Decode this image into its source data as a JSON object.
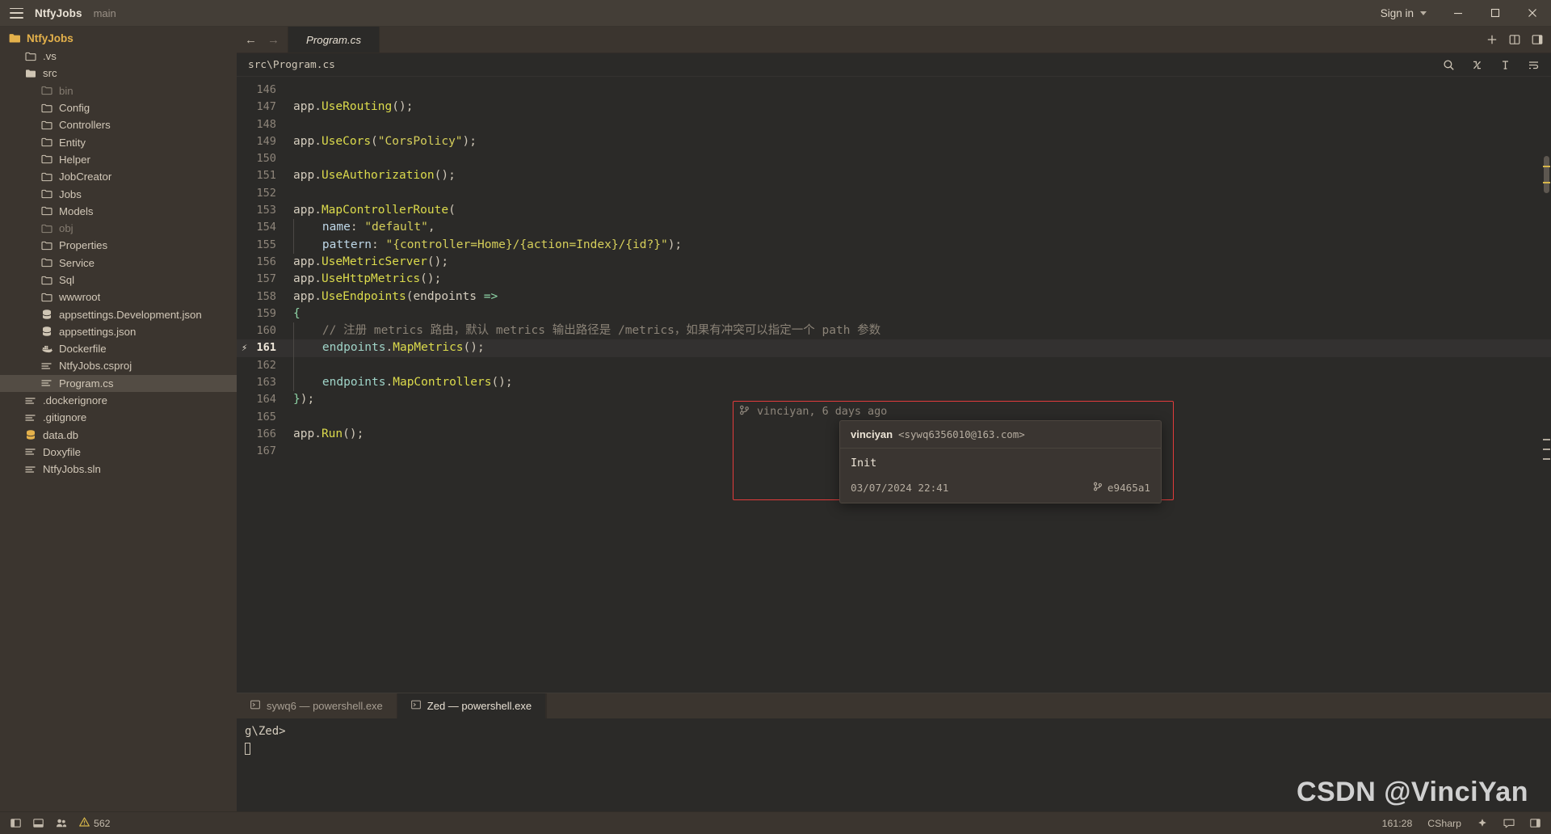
{
  "titlebar": {
    "menu_icon": "hamburger-icon",
    "project": "NtfyJobs",
    "branch": "main",
    "signin": "Sign in",
    "minimize": "minimize-icon",
    "maximize": "maximize-icon",
    "close": "close-icon"
  },
  "sidebar": {
    "root": "NtfyJobs",
    "items": [
      {
        "label": ".vs",
        "type": "folder",
        "depth": 1,
        "dim": false,
        "open": false
      },
      {
        "label": "src",
        "type": "folder-open",
        "depth": 1,
        "dim": false,
        "open": true
      },
      {
        "label": "bin",
        "type": "folder",
        "depth": 2,
        "dim": true,
        "open": false
      },
      {
        "label": "Config",
        "type": "folder",
        "depth": 2,
        "dim": false,
        "open": false
      },
      {
        "label": "Controllers",
        "type": "folder",
        "depth": 2,
        "dim": false,
        "open": false
      },
      {
        "label": "Entity",
        "type": "folder",
        "depth": 2,
        "dim": false,
        "open": false
      },
      {
        "label": "Helper",
        "type": "folder",
        "depth": 2,
        "dim": false,
        "open": false
      },
      {
        "label": "JobCreator",
        "type": "folder",
        "depth": 2,
        "dim": false,
        "open": false
      },
      {
        "label": "Jobs",
        "type": "folder",
        "depth": 2,
        "dim": false,
        "open": false
      },
      {
        "label": "Models",
        "type": "folder",
        "depth": 2,
        "dim": false,
        "open": false
      },
      {
        "label": "obj",
        "type": "folder",
        "depth": 2,
        "dim": true,
        "open": false
      },
      {
        "label": "Properties",
        "type": "folder",
        "depth": 2,
        "dim": false,
        "open": false
      },
      {
        "label": "Service",
        "type": "folder",
        "depth": 2,
        "dim": false,
        "open": false
      },
      {
        "label": "Sql",
        "type": "folder",
        "depth": 2,
        "dim": false,
        "open": false
      },
      {
        "label": "wwwroot",
        "type": "folder",
        "depth": 2,
        "dim": false,
        "open": false
      },
      {
        "label": "appsettings.Development.json",
        "type": "database",
        "depth": 2,
        "dim": false
      },
      {
        "label": "appsettings.json",
        "type": "database",
        "depth": 2,
        "dim": false
      },
      {
        "label": "Dockerfile",
        "type": "docker",
        "depth": 2,
        "dim": false
      },
      {
        "label": "NtfyJobs.csproj",
        "type": "lines",
        "depth": 2,
        "dim": false
      },
      {
        "label": "Program.cs",
        "type": "lines",
        "depth": 2,
        "dim": false,
        "selected": true
      },
      {
        "label": ".dockerignore",
        "type": "lines",
        "depth": 1,
        "dim": false
      },
      {
        "label": ".gitignore",
        "type": "lines",
        "depth": 1,
        "dim": false
      },
      {
        "label": "data.db",
        "type": "db-yellow",
        "depth": 1,
        "dim": false
      },
      {
        "label": "Doxyfile",
        "type": "lines",
        "depth": 1,
        "dim": false
      },
      {
        "label": "NtfyJobs.sln",
        "type": "lines",
        "depth": 1,
        "dim": false
      }
    ]
  },
  "tabbar": {
    "back": "←",
    "forward": "→",
    "tab_label": "Program.cs",
    "plus": "plus-icon",
    "split": "split-pane-icon",
    "panel": "toggle-right-panel-icon"
  },
  "breadcrumb": {
    "path": "src\\Program.cs",
    "search_icon": "search-icon",
    "gitdiff_icon": "git-diff-icon",
    "format_icon": "text-format-icon",
    "wrap_icon": "toggle-wrap-icon"
  },
  "editor": {
    "first_line": 146,
    "active_line": 161,
    "lines": [
      {
        "n": 146,
        "tokens": []
      },
      {
        "n": 147,
        "tokens": [
          {
            "t": "app",
            "c": "t-plain"
          },
          {
            "t": ".",
            "c": "t-punc"
          },
          {
            "t": "UseRouting",
            "c": "t-fn"
          },
          {
            "t": "();",
            "c": "t-punc"
          }
        ]
      },
      {
        "n": 148,
        "tokens": []
      },
      {
        "n": 149,
        "tokens": [
          {
            "t": "app",
            "c": "t-plain"
          },
          {
            "t": ".",
            "c": "t-punc"
          },
          {
            "t": "UseCors",
            "c": "t-fn"
          },
          {
            "t": "(",
            "c": "t-punc"
          },
          {
            "t": "\"CorsPolicy\"",
            "c": "t-str"
          },
          {
            "t": ");",
            "c": "t-punc"
          }
        ]
      },
      {
        "n": 150,
        "tokens": []
      },
      {
        "n": 151,
        "tokens": [
          {
            "t": "app",
            "c": "t-plain"
          },
          {
            "t": ".",
            "c": "t-punc"
          },
          {
            "t": "UseAuthorization",
            "c": "t-fn"
          },
          {
            "t": "();",
            "c": "t-punc"
          }
        ]
      },
      {
        "n": 152,
        "tokens": []
      },
      {
        "n": 153,
        "tokens": [
          {
            "t": "app",
            "c": "t-plain"
          },
          {
            "t": ".",
            "c": "t-punc"
          },
          {
            "t": "MapControllerRoute",
            "c": "t-fn"
          },
          {
            "t": "(",
            "c": "t-punc"
          }
        ]
      },
      {
        "n": 154,
        "indent": 1,
        "tokens": [
          {
            "t": "    ",
            "c": "t-plain"
          },
          {
            "t": "name",
            "c": "t-param"
          },
          {
            "t": ": ",
            "c": "t-punc"
          },
          {
            "t": "\"default\"",
            "c": "t-str"
          },
          {
            "t": ",",
            "c": "t-punc"
          }
        ]
      },
      {
        "n": 155,
        "indent": 1,
        "tokens": [
          {
            "t": "    ",
            "c": "t-plain"
          },
          {
            "t": "pattern",
            "c": "t-param"
          },
          {
            "t": ": ",
            "c": "t-punc"
          },
          {
            "t": "\"{controller=Home}/{action=Index}/{id?}\"",
            "c": "t-str"
          },
          {
            "t": ");",
            "c": "t-punc"
          }
        ]
      },
      {
        "n": 156,
        "tokens": [
          {
            "t": "app",
            "c": "t-plain"
          },
          {
            "t": ".",
            "c": "t-punc"
          },
          {
            "t": "UseMetricServer",
            "c": "t-fn"
          },
          {
            "t": "();",
            "c": "t-punc"
          }
        ]
      },
      {
        "n": 157,
        "tokens": [
          {
            "t": "app",
            "c": "t-plain"
          },
          {
            "t": ".",
            "c": "t-punc"
          },
          {
            "t": "UseHttpMetrics",
            "c": "t-fn"
          },
          {
            "t": "();",
            "c": "t-punc"
          }
        ]
      },
      {
        "n": 158,
        "tokens": [
          {
            "t": "app",
            "c": "t-plain"
          },
          {
            "t": ".",
            "c": "t-punc"
          },
          {
            "t": "UseEndpoints",
            "c": "t-fn"
          },
          {
            "t": "(",
            "c": "t-punc"
          },
          {
            "t": "endpoints ",
            "c": "t-plain"
          },
          {
            "t": "=>",
            "c": "t-op"
          }
        ]
      },
      {
        "n": 159,
        "tokens": [
          {
            "t": "{",
            "c": "t-brace"
          }
        ]
      },
      {
        "n": 160,
        "indent": 1,
        "tokens": [
          {
            "t": "    // 注册 metrics 路由，默认 metrics 输出路径是 /metrics，如果有冲突可以指定一个 path 参数",
            "c": "t-com"
          }
        ]
      },
      {
        "n": 161,
        "indent": 1,
        "active": true,
        "tokens": [
          {
            "t": "    ",
            "c": "t-plain"
          },
          {
            "t": "endpoints",
            "c": "t-var"
          },
          {
            "t": ".",
            "c": "t-punc"
          },
          {
            "t": "MapMetrics",
            "c": "t-fn"
          },
          {
            "t": "();",
            "c": "t-punc"
          }
        ]
      },
      {
        "n": 162,
        "indent": 1,
        "tokens": []
      },
      {
        "n": 163,
        "indent": 1,
        "tokens": [
          {
            "t": "    ",
            "c": "t-plain"
          },
          {
            "t": "endpoints",
            "c": "t-var"
          },
          {
            "t": ".",
            "c": "t-punc"
          },
          {
            "t": "MapControllers",
            "c": "t-fn"
          },
          {
            "t": "();",
            "c": "t-punc"
          }
        ]
      },
      {
        "n": 164,
        "tokens": [
          {
            "t": "}",
            "c": "t-brace"
          },
          {
            "t": ");",
            "c": "t-punc"
          }
        ]
      },
      {
        "n": 165,
        "tokens": []
      },
      {
        "n": 166,
        "tokens": [
          {
            "t": "app",
            "c": "t-plain"
          },
          {
            "t": ".",
            "c": "t-punc"
          },
          {
            "t": "Run",
            "c": "t-fn"
          },
          {
            "t": "();",
            "c": "t-punc"
          }
        ]
      },
      {
        "n": 167,
        "tokens": []
      }
    ]
  },
  "blame": {
    "inline_icon": "git-branch-icon",
    "inline_text": "vinciyan, 6 days ago",
    "author": "vinciyan",
    "email": "<sywq6356010@163.com>",
    "message": "Init",
    "date": "03/07/2024 22:41",
    "sha_icon": "git-branch-icon",
    "sha": "e9465a1",
    "highlight_color": "#e23c3c"
  },
  "terminal": {
    "tabs": [
      {
        "label": "sywq6 — powershell.exe",
        "icon": "terminal-icon",
        "active": false
      },
      {
        "label": "Zed — powershell.exe",
        "icon": "terminal-icon",
        "active": true
      }
    ],
    "prompt": "g\\Zed>"
  },
  "statusbar": {
    "project_icon": "project-panel-icon",
    "terminal_icon": "terminal-panel-icon",
    "collab_icon": "collab-panel-icon",
    "warning_icon": "warning-icon",
    "warning_count": "562",
    "cursor_position": "161:28",
    "language": "CSharp",
    "assistant_icon": "assistant-icon",
    "feedback_icon": "feedback-icon",
    "right_panel_icon": "right-panel-icon"
  },
  "watermark": "CSDN @VinciYan"
}
